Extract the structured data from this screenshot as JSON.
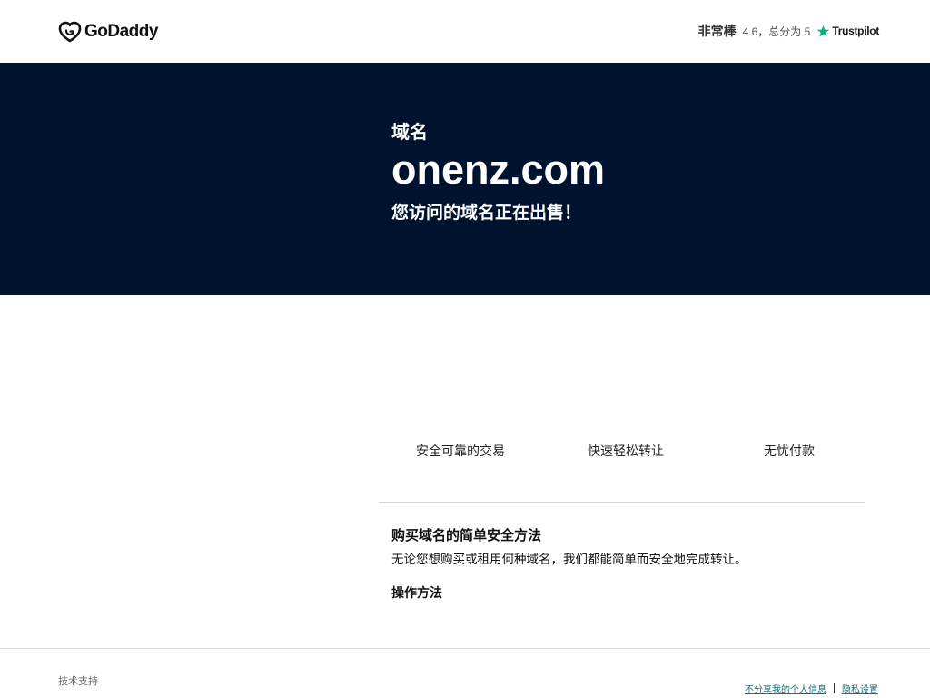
{
  "header": {
    "brand": "GoDaddy",
    "logo_icon": "godaddy-heart-logo",
    "rating": {
      "word": "非常棒",
      "score_text": "4.6，总分为 5",
      "provider": "Trustpilot",
      "provider_icon": "star-icon",
      "star_color": "#00b67a"
    }
  },
  "hero": {
    "label": "域名",
    "domain": "onenz.com",
    "subtitle": "您访问的域名正在出售！",
    "background": "#00132e"
  },
  "features": [
    {
      "label": "安全可靠的交易"
    },
    {
      "label": "快速轻松转让"
    },
    {
      "label": "无忧付款"
    }
  ],
  "info": {
    "title": "购买域名的简单安全方法",
    "description": "无论您想购买或租用何种域名，我们都能简单而安全地完成转让。",
    "howto_label": "操作方法"
  },
  "footer": {
    "support_label": "技术支持",
    "links": [
      {
        "label": "不分享我的个人信息"
      },
      {
        "label": "隐私设置"
      }
    ],
    "link_color": "#1b6e73"
  }
}
